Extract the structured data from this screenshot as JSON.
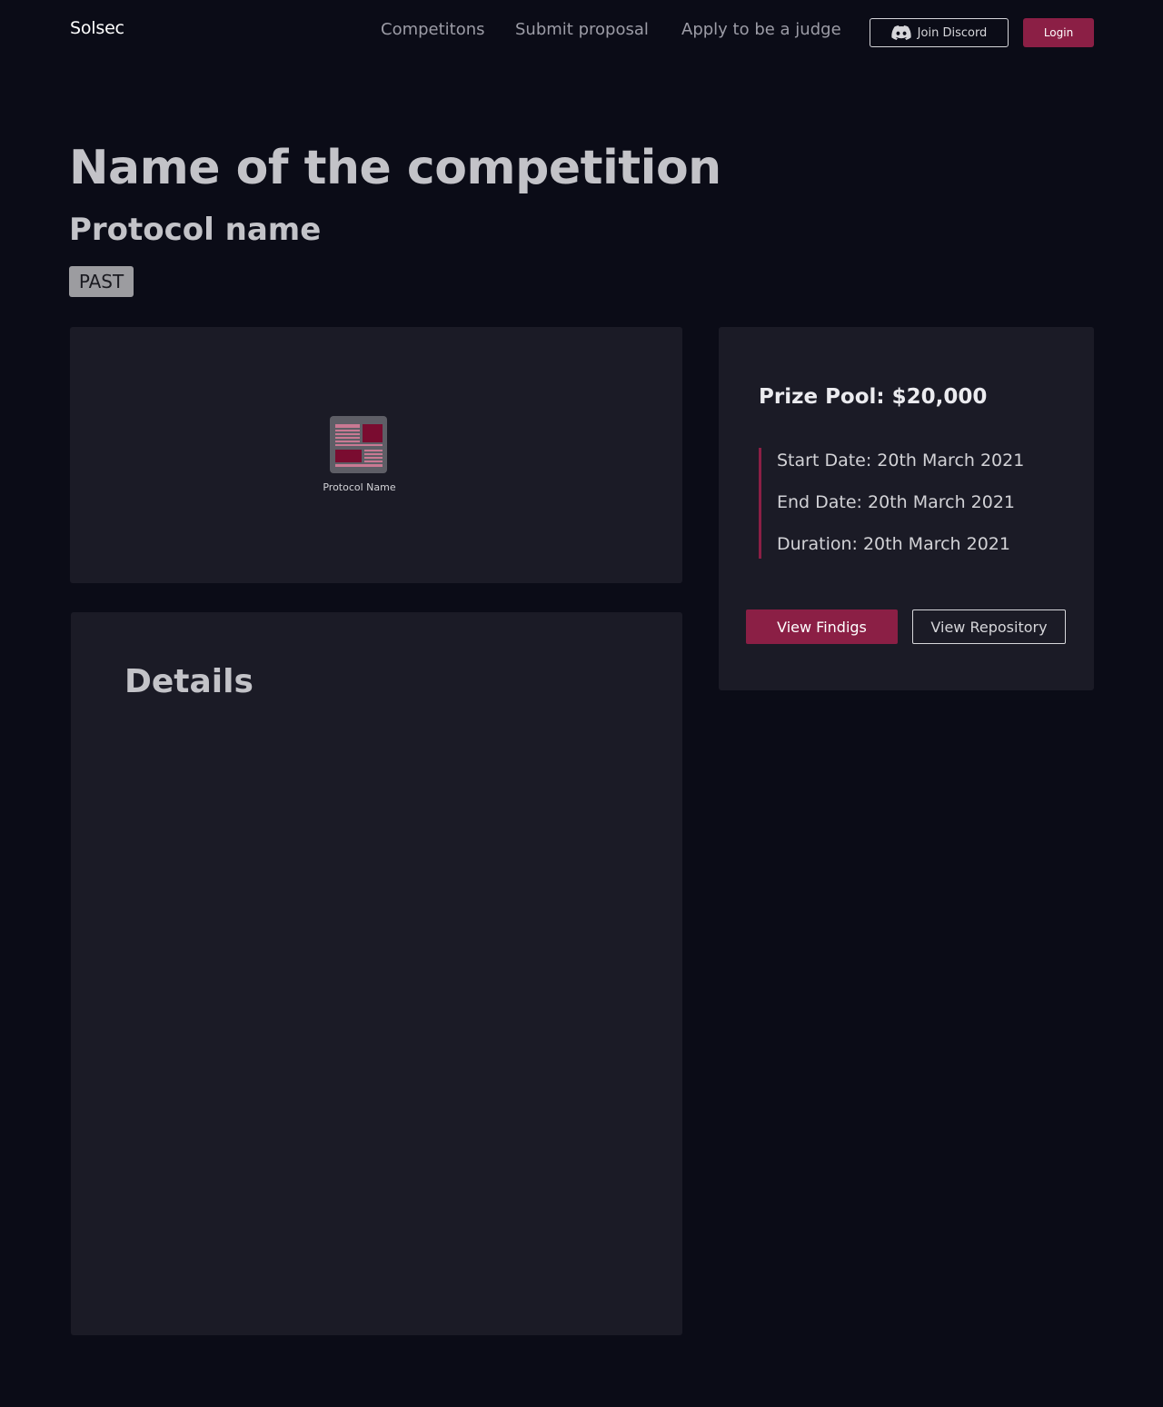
{
  "header": {
    "brand": "Solsec",
    "nav": {
      "competitions": "Competitons",
      "submit_proposal": "Submit proposal",
      "apply_judge": "Apply to be a judge"
    },
    "discord_label": "Join Discord",
    "login_label": "Login"
  },
  "hero": {
    "title": "Name of the competition",
    "protocol": "Protocol name",
    "status": "PAST"
  },
  "protocol_card": {
    "caption": "Protocol Name"
  },
  "prize": {
    "title": "Prize Pool: $20,000",
    "start": "Start Date: 20th March 2021",
    "end": "End Date: 20th March 2021",
    "duration": "Duration: 20th March 2021",
    "findings_label": "View Findigs",
    "repo_label": "View Repository"
  },
  "details": {
    "heading": "Details"
  },
  "colors": {
    "background": "#0b0c17",
    "card": "#1b1b26",
    "accent": "#8b1f45",
    "badge": "#9c9ca0"
  },
  "icons": {
    "discord": "discord-icon",
    "protocol_logo": "document-layout-icon"
  }
}
